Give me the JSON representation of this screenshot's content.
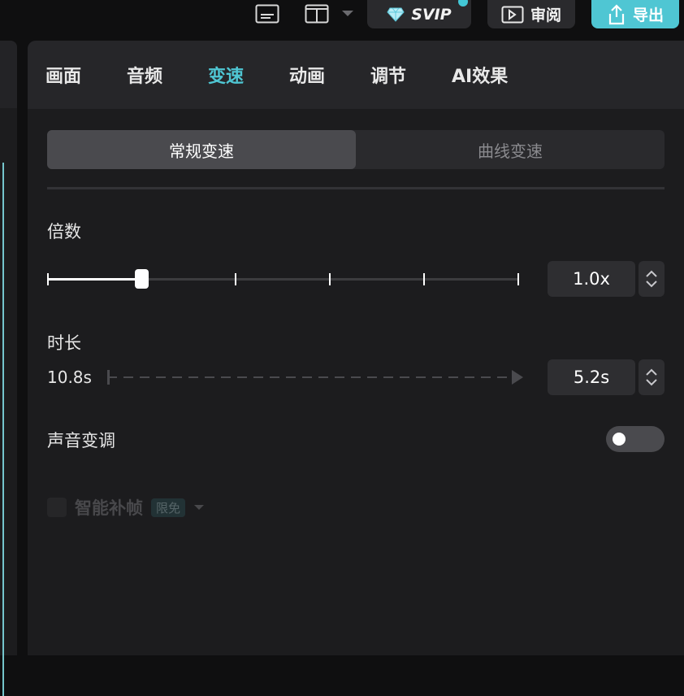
{
  "topbar": {
    "svip_label": "SVIP",
    "review_label": "审阅",
    "export_label": "导出",
    "accent_color": "#4fc6d3"
  },
  "tabs": [
    {
      "label": "画面"
    },
    {
      "label": "音频"
    },
    {
      "label": "变速",
      "active": true
    },
    {
      "label": "动画"
    },
    {
      "label": "调节"
    },
    {
      "label": "AI效果"
    }
  ],
  "speed_mode": {
    "options": [
      "常规变速",
      "曲线变速"
    ],
    "selected": "常规变速"
  },
  "multiplier": {
    "label": "倍数",
    "value": "1.0x",
    "slider_fraction": 0.2
  },
  "duration": {
    "label": "时长",
    "original": "10.8s",
    "value": "5.2s"
  },
  "pitch": {
    "label": "声音变调",
    "enabled": false
  },
  "smart_frame": {
    "label": "智能补帧",
    "badge": "限免",
    "enabled": false
  }
}
